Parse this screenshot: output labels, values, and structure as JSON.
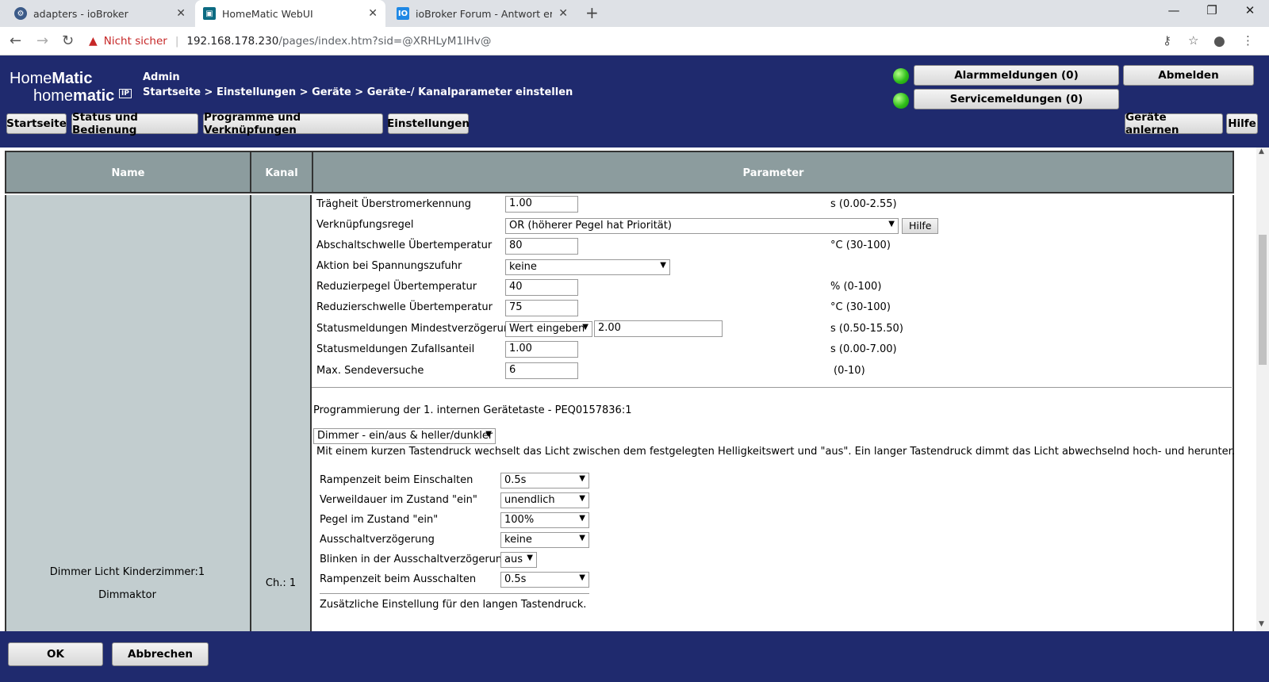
{
  "browser": {
    "tabs": [
      {
        "title": "adapters - ioBroker",
        "icon": "iobroker-gear-icon"
      },
      {
        "title": "HomeMatic WebUI",
        "icon": "homematic-icon"
      },
      {
        "title": "ioBroker Forum - Antwort erstelle",
        "icon": "iobroker-forum-icon"
      }
    ],
    "security_label": "Nicht sicher",
    "url_host": "192.168.178.230",
    "url_path": "/pages/index.htm?sid=@XRHLyM1lHv@"
  },
  "header": {
    "logo_line1_a": "Home",
    "logo_line1_b": "Matic",
    "logo_line2_a": "home",
    "logo_line2_b": "matic",
    "logo_badge": "IP",
    "user": "Admin",
    "breadcrumb": "Startseite > Einstellungen > Geräte > Geräte-/ Kanalparameter einstellen",
    "alarm_button": "Alarmmeldungen (0)",
    "service_button": "Servicemeldungen (0)",
    "logout_button": "Abmelden",
    "nav": [
      "Startseite",
      "Status und Bedienung",
      "Programme und Verknüpfungen",
      "Einstellungen"
    ],
    "learn_button": "Geräte anlernen",
    "help_button": "Hilfe"
  },
  "table": {
    "headers": {
      "name": "Name",
      "kanal": "Kanal",
      "parameter": "Parameter"
    },
    "device_name": "Dimmer Licht Kinderzimmer:1",
    "device_type": "Dimmaktor",
    "channel": "Ch.: 1"
  },
  "params": [
    {
      "label": "Trägheit Überstromerkennung",
      "value": "1.00",
      "unit": "s (0.00-2.55)"
    },
    {
      "label": "Verknüpfungsregel",
      "value": "OR (höherer Pegel hat Priorität)",
      "button": "Hilfe"
    },
    {
      "label": "Abschaltschwelle Übertemperatur",
      "value": "80",
      "unit": "°C (30-100)"
    },
    {
      "label": "Aktion bei Spannungszufuhr",
      "value": "keine"
    },
    {
      "label": "Reduzierpegel Übertemperatur",
      "value": "40",
      "unit": "% (0-100)"
    },
    {
      "label": "Reduzierschwelle Übertemperatur",
      "value": "75",
      "unit": "°C (30-100)"
    },
    {
      "label": "Statusmeldungen Mindestverzögerung",
      "select": "Wert eingeben",
      "value": "2.00",
      "unit": "s (0.50-15.50)"
    },
    {
      "label": "Statusmeldungen Zufallsanteil",
      "value": "1.00",
      "unit": "s (0.00-7.00)"
    },
    {
      "label": "Max. Sendeversuche",
      "value": "6",
      "unit": "(0-10)"
    }
  ],
  "programming": {
    "title": "Programmierung der 1. internen Gerätetaste - PEQ0157836:1",
    "profile": "Dimmer - ein/aus & heller/dunkler",
    "description": "Mit einem kurzen Tastendruck wechselt das Licht zwischen dem festgelegten Helligkeitswert und \"aus\". Ein langer Tastendruck dimmt das Licht abwechselnd hoch- und herunter.",
    "rows": [
      {
        "label": "Rampenzeit beim Einschalten",
        "value": "0.5s"
      },
      {
        "label": "Verweildauer im Zustand \"ein\"",
        "value": "unendlich"
      },
      {
        "label": "Pegel im Zustand \"ein\"",
        "value": "100%"
      },
      {
        "label": "Ausschaltverzögerung",
        "value": "keine"
      },
      {
        "label": "Blinken in der Ausschaltverzögerung",
        "value": "aus"
      },
      {
        "label": "Rampenzeit beim Ausschalten",
        "value": "0.5s"
      }
    ],
    "extra": "Zusätzliche Einstellung für den langen Tastendruck."
  },
  "footer": {
    "ok": "OK",
    "cancel": "Abbrechen"
  },
  "colors": {
    "header_bg": "#1f2a6e",
    "table_head": "#8c9c9e",
    "table_col": "#c2cdcf",
    "led": "#2fbf1a"
  }
}
